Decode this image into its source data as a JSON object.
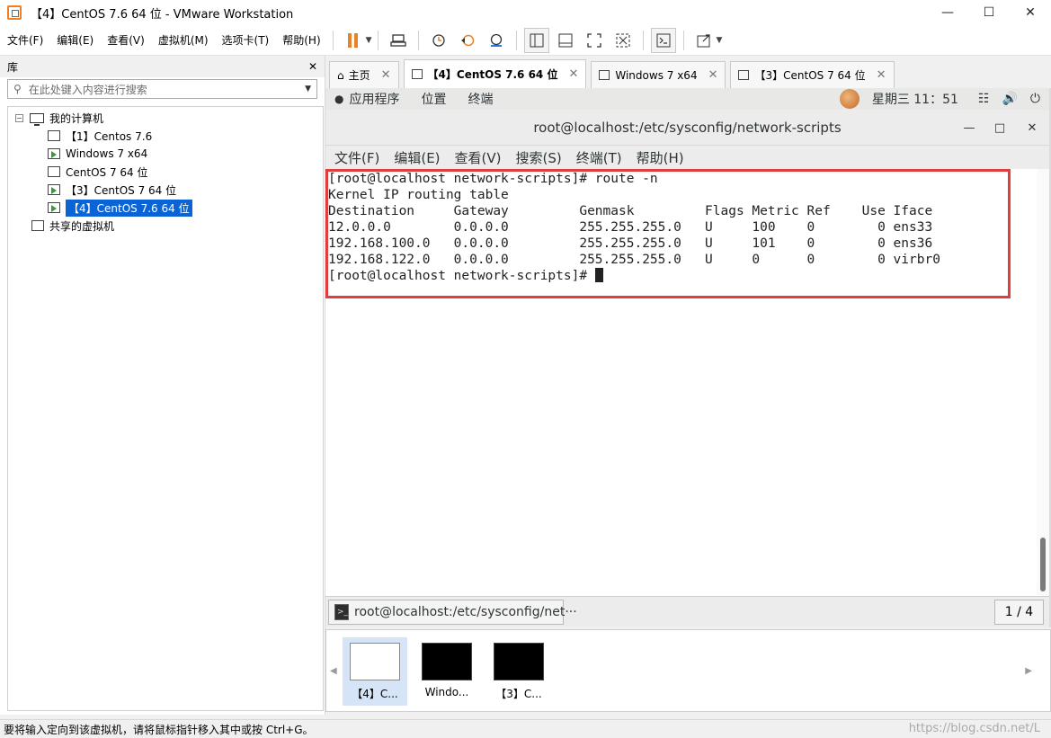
{
  "window": {
    "title": "【4】CentOS 7.6 64 位 - VMware Workstation",
    "controls": [
      "minimize",
      "maximize",
      "close"
    ]
  },
  "menu": [
    "文件(F)",
    "编辑(E)",
    "查看(V)",
    "虚拟机(M)",
    "选项卡(T)",
    "帮助(H)"
  ],
  "toolbar": {
    "icons": [
      "pause-icon",
      "send-keys-icon",
      "snapshot-icon",
      "revert-snapshot-icon",
      "snapshot-manager-icon",
      "library-view-icon",
      "thumbnail-view-icon",
      "fullscreen-icon",
      "unity-icon",
      "console-icon",
      "stretch-icon"
    ]
  },
  "library": {
    "title": "库",
    "search_placeholder": "在此处键入内容进行搜索",
    "root": "我的计算机",
    "vms": [
      "【1】Centos 7.6",
      "Windows 7 x64",
      "CentOS 7 64 位",
      "【3】CentOS 7 64 位",
      "【4】CentOS 7.6 64 位"
    ],
    "shared": "共享的虚拟机",
    "selected": "【4】CentOS 7.6 64 位"
  },
  "tabs": [
    {
      "label": "主页"
    },
    {
      "label": "【4】CentOS 7.6 64 位",
      "active": true
    },
    {
      "label": "Windows 7 x64"
    },
    {
      "label": "【3】CentOS 7 64 位"
    }
  ],
  "gnome": {
    "apps": "应用程序",
    "places": "位置",
    "terminal": "终端",
    "clock": "星期三 11：51"
  },
  "terminal": {
    "title": "root@localhost:/etc/sysconfig/network-scripts",
    "menu": [
      "文件(F)",
      "编辑(E)",
      "查看(V)",
      "搜索(S)",
      "终端(T)",
      "帮助(H)"
    ],
    "lines": [
      "[root@localhost network-scripts]# route -n",
      "Kernel IP routing table",
      "Destination     Gateway         Genmask         Flags Metric Ref    Use Iface",
      "12.0.0.0        0.0.0.0         255.255.255.0   U     100    0        0 ens33",
      "192.168.100.0   0.0.0.0         255.255.255.0   U     101    0        0 ens36",
      "192.168.122.0   0.0.0.0         255.255.255.0   U     0      0        0 virbr0"
    ],
    "prompt": "[root@localhost network-scripts]# "
  },
  "guest_taskbar": {
    "item": "root@localhost:/etc/sysconfig/net···",
    "workspace": "1 / 4"
  },
  "thumbnails": [
    "【4】C...",
    "Windo...",
    "【3】C..."
  ],
  "status": {
    "text": "要将输入定向到该虚拟机，请将鼠标指针移入其中或按 Ctrl+G。",
    "watermark": "https://blog.csdn.net/L"
  },
  "colors": {
    "accent_orange": "#e8812a",
    "selection_blue": "#0a64d6",
    "highlight_red": "#e03e3e"
  }
}
